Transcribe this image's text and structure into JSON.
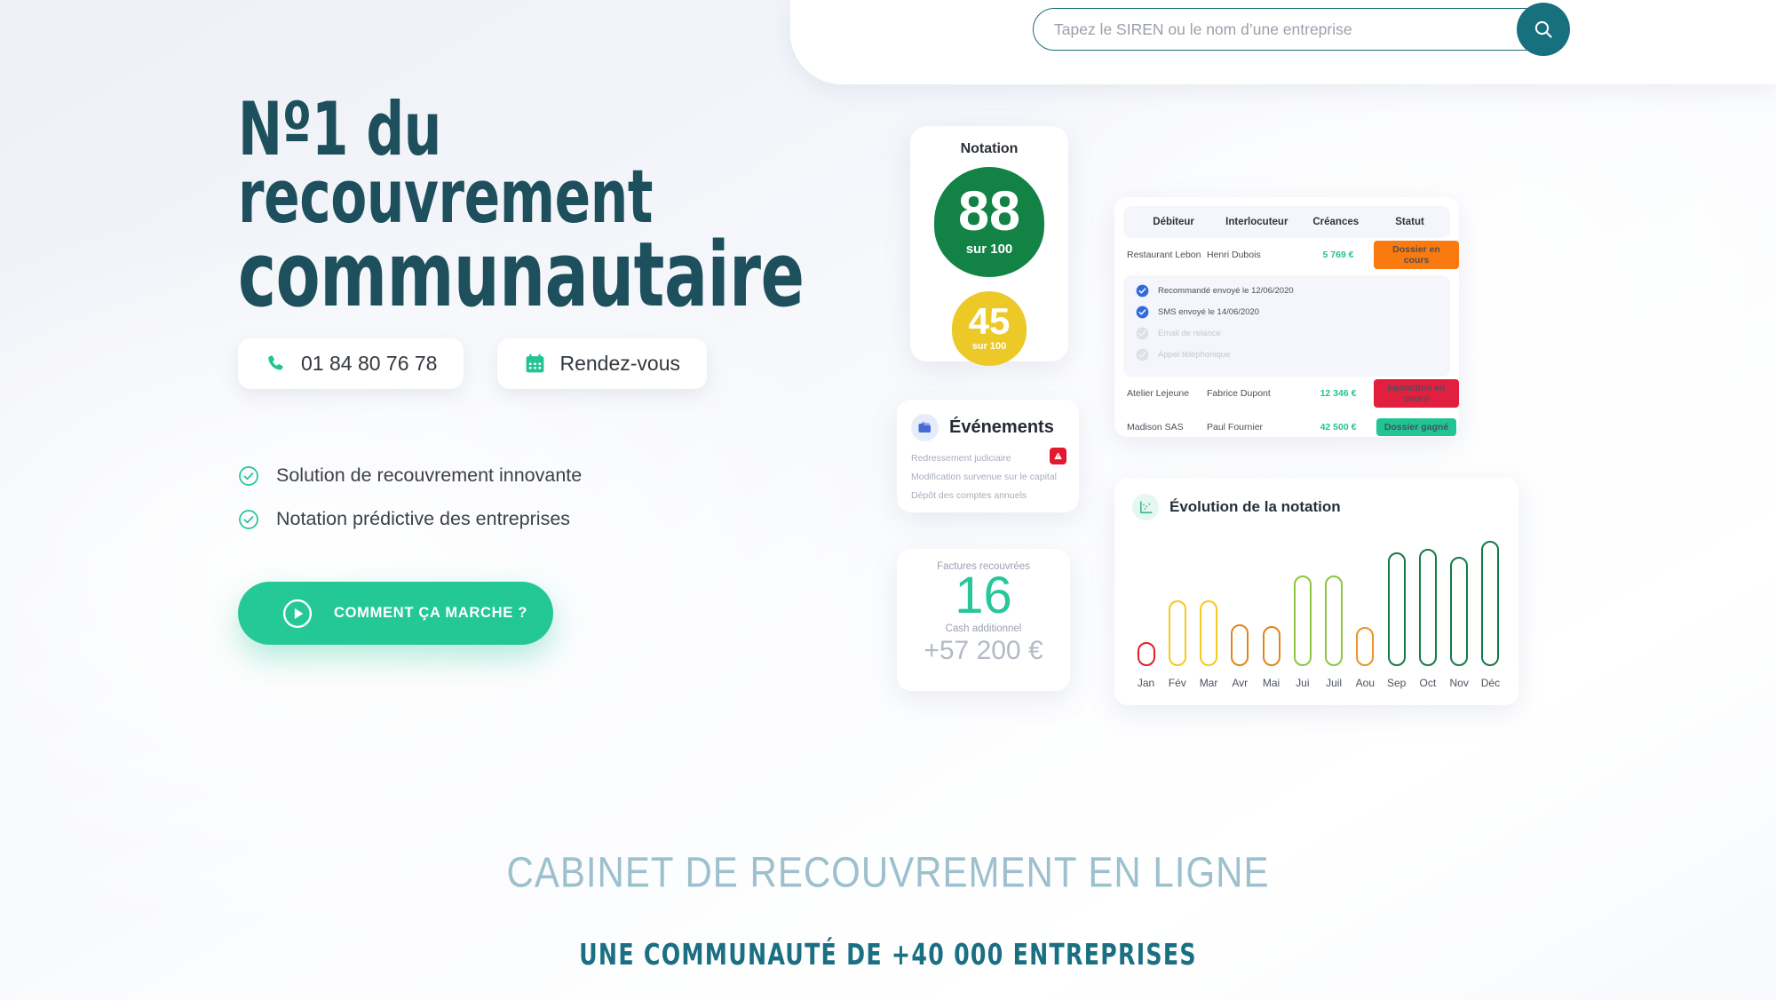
{
  "search": {
    "placeholder": "Tapez le SIREN ou le nom d’une entreprise",
    "value": "",
    "button_icon": "search-icon"
  },
  "hero": {
    "title_line1": "Nº1 du recouvrement",
    "title_line2": "communautaire",
    "phone_button": "01 84 80 76 78",
    "appointment_button": "Rendez-vous",
    "features": [
      "Solution de recouvrement innovante",
      "Notation prédictive des entreprises"
    ],
    "cta_label": "COMMENT ÇA MARCHE ?"
  },
  "notation_card": {
    "title": "Notation",
    "primary_score": "88",
    "primary_suffix": "sur 100",
    "secondary_score": "45",
    "secondary_suffix": "sur 100",
    "primary_color": "#128345",
    "secondary_color": "#ecc927"
  },
  "events_card": {
    "title": "Événements",
    "icon": "folder-icon",
    "items": [
      {
        "label": "Redressement judiciaire",
        "warning": true
      },
      {
        "label": "Modification survenue sur le capital",
        "warning": false
      },
      {
        "label": "Dépôt des comptes annuels",
        "warning": false
      }
    ]
  },
  "invoices_card": {
    "label_count": "Factures recouvrées",
    "count": "16",
    "label_cash": "Cash additionnel",
    "cash": "+57 200 €"
  },
  "table_card": {
    "headers": [
      "Débiteur",
      "Interlocuteur",
      "Créances",
      "Statut"
    ],
    "rows": [
      {
        "debtor": "Restaurant Lebon",
        "contact": "Henri Dubois",
        "amount": "5 769 €",
        "status": "Dossier en cours",
        "status_color": "#fa7a10"
      },
      {
        "debtor": "Atelier Lejeune",
        "contact": "Fabrice Dupont",
        "amount": "12 346 €",
        "status": "Injonction en cours",
        "status_color": "#e21f3f"
      },
      {
        "debtor": "Madison SAS",
        "contact": "Paul Fournier",
        "amount": "42 500 €",
        "status": "Dossier gagné",
        "status_color": "#21c493"
      }
    ],
    "steps": [
      {
        "label": "Recommandé envoyé le 12/06/2020",
        "done": true
      },
      {
        "label": "SMS envoyé le 14/06/2020",
        "done": true
      },
      {
        "label": "Email de relance",
        "done": false
      },
      {
        "label": "Appel téléphonique",
        "done": false
      }
    ]
  },
  "chart_card": {
    "title": "Évolution de la notation",
    "icon": "chart-icon"
  },
  "chart_data": {
    "type": "bar",
    "title": "Évolution de la notation",
    "categories": [
      "Jan",
      "Fév",
      "Mar",
      "Avr",
      "Mai",
      "Jui",
      "Juil",
      "Aou",
      "Sep",
      "Oct",
      "Nov",
      "Déc"
    ],
    "values": [
      18,
      49,
      49,
      31,
      30,
      68,
      68,
      29,
      85,
      88,
      82,
      94
    ],
    "colors": [
      "#e01f26",
      "#f5ca1e",
      "#f5ca1e",
      "#e08520",
      "#e08520",
      "#8cc63f",
      "#8cc63f",
      "#e8932a",
      "#147a47",
      "#147a47",
      "#147a47",
      "#147a47"
    ],
    "xlabel": "",
    "ylabel": "",
    "ylim": [
      0,
      100
    ],
    "grid": false,
    "legend": "none"
  },
  "bottom": {
    "strapline": "CABINET DE RECOUVREMENT EN LIGNE",
    "community": "UNE COMMUNAUTÉ DE +40 000 ENTREPRISES"
  }
}
